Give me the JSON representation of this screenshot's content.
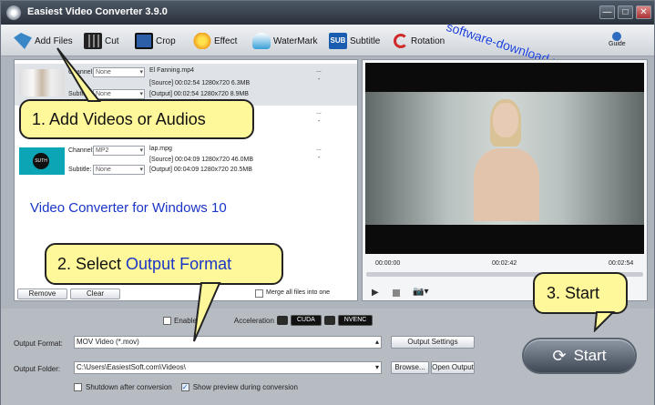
{
  "app": {
    "title": "Easiest Video Converter 3.9.0"
  },
  "window_controls": {
    "minimize": "—",
    "maximize": "□",
    "close": "✕"
  },
  "toolbar": {
    "add_files": "Add Files",
    "cut": "Cut",
    "crop": "Crop",
    "effect": "Effect",
    "watermark": "WaterMark",
    "subtitle": "Subtitle",
    "subtitle_icon_text": "SUB",
    "rotation": "Rotation",
    "guide": "Guide"
  },
  "site_watermark": "software-download.name",
  "files": [
    {
      "name": "El Fanning.mp4",
      "channel_label": "Channel:",
      "channel": "None",
      "subtitle_label": "Subtitle:",
      "subtitle": "None",
      "source": "[Source]  00:02:54  1280x720  6.3MB",
      "output": "[Output]  00:02:54  1280x720  8.9MB",
      "dots": "...",
      "dash": "-"
    },
    {
      "name": "",
      "channel_label": "",
      "channel": "",
      "subtitle_label": "",
      "subtitle": "",
      "source": "",
      "output": "",
      "dots": "...",
      "dash": "-"
    },
    {
      "name": "lap.mpg",
      "channel_label": "Channel:",
      "channel": "MP2",
      "subtitle_label": "Subtitle:",
      "subtitle": "None",
      "source": "[Source]  00:04:09  1280x720  46.0MB",
      "output": "[Output]  00:04:09  1280x720  20.5MB",
      "dots": "...",
      "dash": "-",
      "thumb_text": "SUTH"
    }
  ],
  "file_footer": {
    "remove": "Remove",
    "clear": "Clear",
    "merge": "Merge all files into one"
  },
  "overlay_label": "Video Converter for Windows 10",
  "preview": {
    "time_start": "00:00:00",
    "time_mid": "00:02:42",
    "time_end": "00:02:54",
    "play": "▶",
    "camera": "📷▾"
  },
  "gpu": {
    "enable_prefix": "Enable",
    "enable_suffix": "Acceleration",
    "cuda": "CUDA",
    "nvenc": "NVENC"
  },
  "output": {
    "format_label": "Output Format:",
    "format_value": "MOV Video (*.mov)",
    "settings_btn": "Output Settings",
    "folder_label": "Output Folder:",
    "folder_value": "C:\\Users\\EasiestSoft.com\\Videos\\",
    "browse_btn": "Browse...",
    "open_btn": "Open Output",
    "shutdown_label": "Shutdown after conversion",
    "show_preview_label": "Show preview during conversion"
  },
  "start": {
    "label": "Start",
    "icon": "⟳"
  },
  "callouts": {
    "c1": "1. Add Videos or Audios",
    "c2_prefix": "2. Select",
    "c2_highlight": "Output Format",
    "c3": "3. Start"
  }
}
